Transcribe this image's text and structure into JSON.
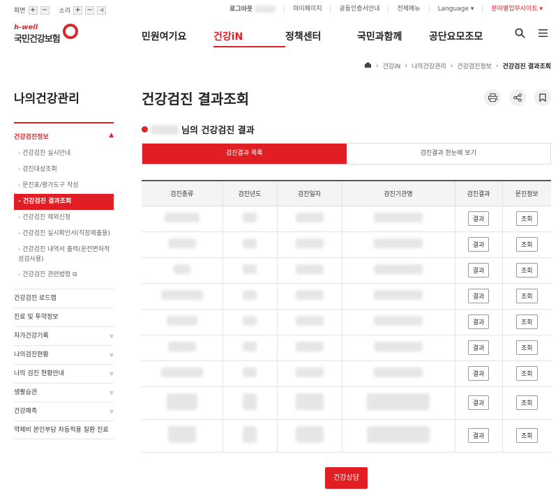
{
  "utility": {
    "screen_label": "화면",
    "sound_label": "소리",
    "logout": "로그아웃",
    "mypage": "마이페이지",
    "cert": "공동인증서안내",
    "allmenu": "전체메뉴",
    "language": "Language ▾",
    "branch": "분야별업무사이트 ▾"
  },
  "logo": {
    "hwell": "h-well",
    "name": "국민건강보험"
  },
  "gnb": [
    "민원여기요",
    "건강iN",
    "정책센터",
    "국민과함께",
    "공단요모조모"
  ],
  "breadcrumb": [
    "건강iN",
    "나의건강관리",
    "건강검진정보",
    "건강검진 결과조회"
  ],
  "sidebar": {
    "title": "나의건강관리",
    "group": "건강검진정보",
    "sub_items": [
      "건강검진 실시안내",
      "검진대상조회",
      "문진표/평가도구 작성",
      "건강검진 결과조회",
      "건강검진 제외신청",
      "건강검진 실시확인서(직장제출용)",
      "건강검진 내역서 출력(운전면허적성검사용)",
      "건강검진 관련법령"
    ],
    "menus": [
      {
        "label": "건강검진 로드맵",
        "arrow": ""
      },
      {
        "label": "진료 및 투약정보",
        "arrow": ""
      },
      {
        "label": "자가건강기록",
        "arrow": "▼"
      },
      {
        "label": "나의검진현황",
        "arrow": "▼"
      },
      {
        "label": "나의 검진 현황안내",
        "arrow": "▼"
      },
      {
        "label": "생활습관",
        "arrow": "▼"
      },
      {
        "label": "건강예측",
        "arrow": "▼"
      },
      {
        "label": "약제비 본인부담 차등적용 질환 진료",
        "arrow": ""
      }
    ]
  },
  "page": {
    "title": "건강검진 결과조회",
    "user_suffix": "님의 건강검진 결과",
    "tabs": [
      "검진결과 목록",
      "검진결과 한눈에 보기"
    ],
    "columns": [
      "검진종류",
      "검진년도",
      "검진일자",
      "검진기관명",
      "검진결과",
      "문진정보"
    ],
    "result_btn": "결과",
    "inquiry_btn": "조회",
    "consult_btn": "건강상담"
  },
  "colors": {
    "brand": "#e01e24"
  }
}
